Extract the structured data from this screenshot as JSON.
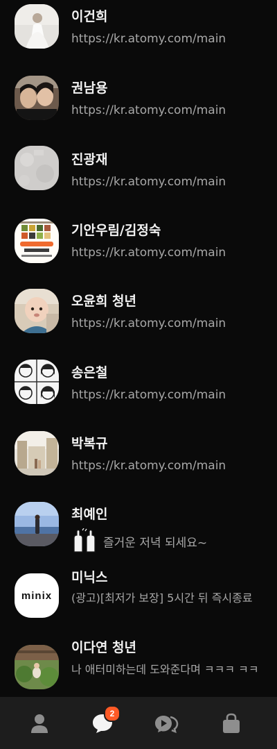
{
  "chats": [
    {
      "name": "이건희",
      "preview": "https://kr.atomy.com/main"
    },
    {
      "name": "권남용",
      "preview": "https://kr.atomy.com/main"
    },
    {
      "name": "진광재",
      "preview": "https://kr.atomy.com/main"
    },
    {
      "name": "기안우림/김정숙",
      "preview": "https://kr.atomy.com/main"
    },
    {
      "name": "오윤희 청년",
      "preview": "https://kr.atomy.com/main"
    },
    {
      "name": "송은철",
      "preview": "https://kr.atomy.com/main"
    },
    {
      "name": "박복규",
      "preview": "https://kr.atomy.com/main"
    },
    {
      "name": "최예인",
      "preview": "즐거운 저녁 되세요~"
    },
    {
      "name": "미닉스",
      "preview": "(광고)[최저가 보장] 5시간 뒤 즉시종료",
      "avatar_text": "minix"
    },
    {
      "name": "이다연 청년",
      "preview": "나 애터미하는데 도와준다며 ㅋㅋㅋ ㅋㅋ"
    }
  ],
  "tabbar": {
    "items": [
      {
        "name": "friends",
        "icon": "person-icon"
      },
      {
        "name": "chats",
        "icon": "chat-bubble-icon",
        "badge": "2"
      },
      {
        "name": "open-chat",
        "icon": "open-chat-icon"
      },
      {
        "name": "shopping",
        "icon": "shopping-bag-icon"
      }
    ]
  },
  "colors": {
    "background": "#0a0a0a",
    "tabbar": "#1d1d1d",
    "badge": "#ff5a26",
    "name_text": "#f2f2f2",
    "preview_text": "#a8a8a8"
  }
}
